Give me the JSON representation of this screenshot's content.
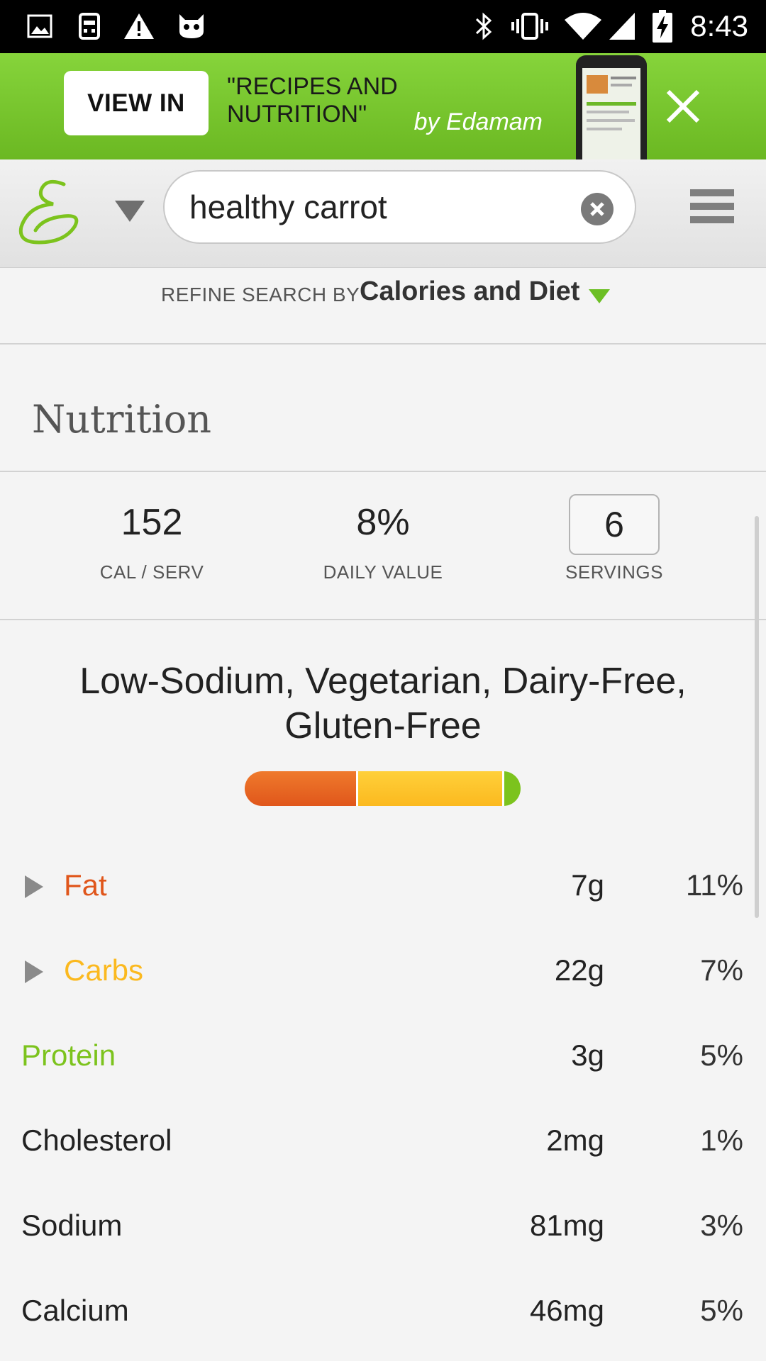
{
  "status_bar": {
    "time": "8:43",
    "left_icons": [
      "image-icon",
      "sim-card-icon",
      "warning-icon",
      "cat-icon"
    ],
    "right_icons": [
      "bluetooth-icon",
      "vibrate-icon",
      "wifi-icon",
      "signal-icon",
      "battery-charging-icon"
    ]
  },
  "banner": {
    "button_label": "VIEW IN",
    "title": "\"RECIPES AND NUTRITION\"",
    "subtitle": "by Edamam",
    "close_icon": "close-icon"
  },
  "search": {
    "value": "healthy carrot",
    "clear_icon": "clear-icon",
    "menu_icon": "hamburger-menu-icon",
    "logo_icon": "edamam-logo"
  },
  "refine": {
    "label": "REFINE SEARCH BY",
    "value": "Calories and Diet"
  },
  "nutrition": {
    "title": "Nutrition",
    "stats": [
      {
        "value": "152",
        "label": "CAL / SERV"
      },
      {
        "value": "8%",
        "label": "DAILY VALUE"
      },
      {
        "value": "6",
        "label": "SERVINGS"
      }
    ],
    "diet_labels": "Low-Sodium, Vegetarian, Dairy-Free, Gluten-Free",
    "macro_bar": {
      "fat_fraction": 0.41,
      "carbs_fraction": 0.53,
      "protein_fraction": 0.06,
      "colors": {
        "fat": "#e0561b",
        "carbs": "#fbb91f",
        "protein": "#7cc31d"
      }
    },
    "rows": [
      {
        "name": "Fat",
        "amount": "7g",
        "percent": "11%",
        "color": "#e0561b",
        "expandable": true
      },
      {
        "name": "Carbs",
        "amount": "22g",
        "percent": "7%",
        "color": "#fbb91f",
        "expandable": true
      },
      {
        "name": "Protein",
        "amount": "3g",
        "percent": "5%",
        "color": "#7cc31d",
        "expandable": false
      },
      {
        "name": "Cholesterol",
        "amount": "2mg",
        "percent": "1%",
        "color": "#222222",
        "expandable": false
      },
      {
        "name": "Sodium",
        "amount": "81mg",
        "percent": "3%",
        "color": "#222222",
        "expandable": false
      },
      {
        "name": "Calcium",
        "amount": "46mg",
        "percent": "5%",
        "color": "#222222",
        "expandable": false
      }
    ]
  }
}
